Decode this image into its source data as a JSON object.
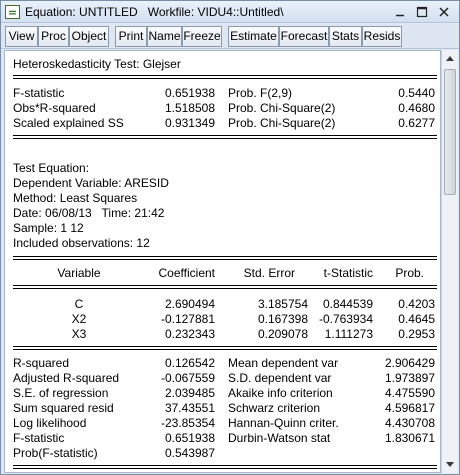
{
  "window": {
    "title": "Equation: UNTITLED   Workfile: VIDU4::Untitled\\"
  },
  "toolbar": {
    "buttons": [
      "View",
      "Proc",
      "Object",
      "Print",
      "Name",
      "Freeze",
      "Estimate",
      "Forecast",
      "Stats",
      "Resids"
    ]
  },
  "output": {
    "test_title": "Heteroskedasticity Test: Glejser",
    "test_stats": [
      {
        "label": "F-statistic",
        "value": "0.651938",
        "prob_label": "Prob. F(2,9)",
        "prob": "0.5440"
      },
      {
        "label": "Obs*R-squared",
        "value": "1.518508",
        "prob_label": "Prob. Chi-Square(2)",
        "prob": "0.4680"
      },
      {
        "label": "Scaled explained SS",
        "value": "0.931349",
        "prob_label": "Prob. Chi-Square(2)",
        "prob": "0.6277"
      }
    ],
    "info": [
      "Test Equation:",
      "Dependent Variable: ARESID",
      "Method: Least Squares",
      "Date: 06/08/13   Time: 21:42",
      "Sample: 1 12",
      "Included observations: 12"
    ],
    "coef_headers": [
      "Variable",
      "Coefficient",
      "Std. Error",
      "t-Statistic",
      "Prob."
    ],
    "coef_rows": [
      [
        "C",
        "2.690494",
        "3.185754",
        "0.844539",
        "0.4203"
      ],
      [
        "X2",
        "-0.127881",
        "0.167398",
        "-0.763934",
        "0.4645"
      ],
      [
        "X3",
        "0.232343",
        "0.209078",
        "1.111273",
        "0.2953"
      ]
    ],
    "summary_rows": [
      {
        "l_label": "R-squared",
        "l_value": "0.126542",
        "r_label": "Mean dependent var",
        "r_value": "2.906429"
      },
      {
        "l_label": "Adjusted R-squared",
        "l_value": "-0.067559",
        "r_label": "S.D. dependent var",
        "r_value": "1.973897"
      },
      {
        "l_label": "S.E. of regression",
        "l_value": "2.039485",
        "r_label": "Akaike info criterion",
        "r_value": "4.475590"
      },
      {
        "l_label": "Sum squared resid",
        "l_value": "37.43551",
        "r_label": "Schwarz criterion",
        "r_value": "4.596817"
      },
      {
        "l_label": "Log likelihood",
        "l_value": "-23.85354",
        "r_label": "Hannan-Quinn criter.",
        "r_value": "4.430708"
      },
      {
        "l_label": "F-statistic",
        "l_value": "0.651938",
        "r_label": "Durbin-Watson stat",
        "r_value": "1.830671"
      },
      {
        "l_label": "Prob(F-statistic)",
        "l_value": "0.543987",
        "r_label": "",
        "r_value": ""
      }
    ]
  }
}
